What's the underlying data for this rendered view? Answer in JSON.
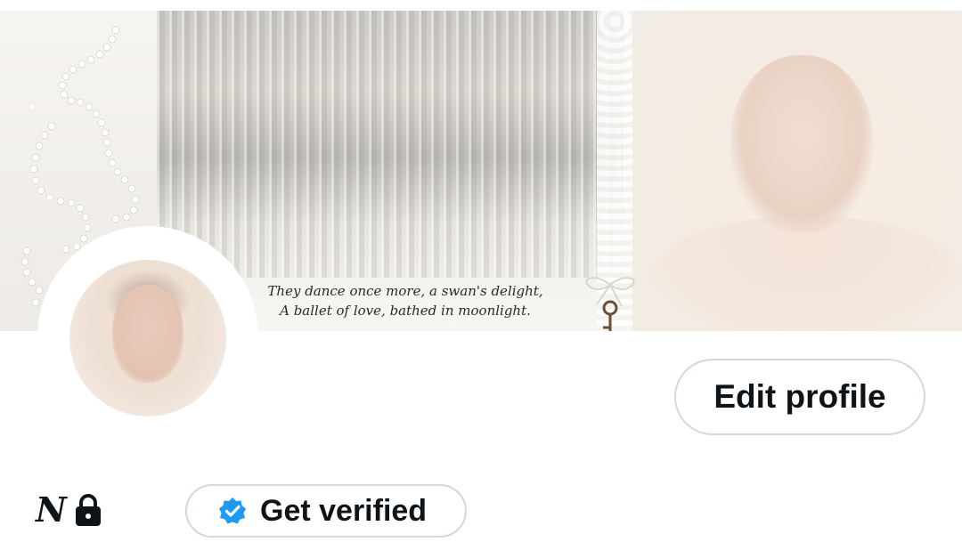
{
  "banner": {
    "poem_line_1": "They dance once more, a swan's delight,",
    "poem_line_2": "A ballet of love, bathed in moonlight."
  },
  "profile": {
    "edit_button_label": "Edit profile",
    "name_glyph": "N",
    "get_verified_label": "Get verified"
  },
  "icons": {
    "lock": "lock-icon",
    "verified": "verified-badge-icon",
    "key": "key-icon",
    "pearl_swirl": "pearl-swirl-decoration"
  },
  "colors": {
    "text_primary": "#0f1419",
    "button_border": "#cfd9de",
    "verified_blue": "#1d9bf0"
  }
}
